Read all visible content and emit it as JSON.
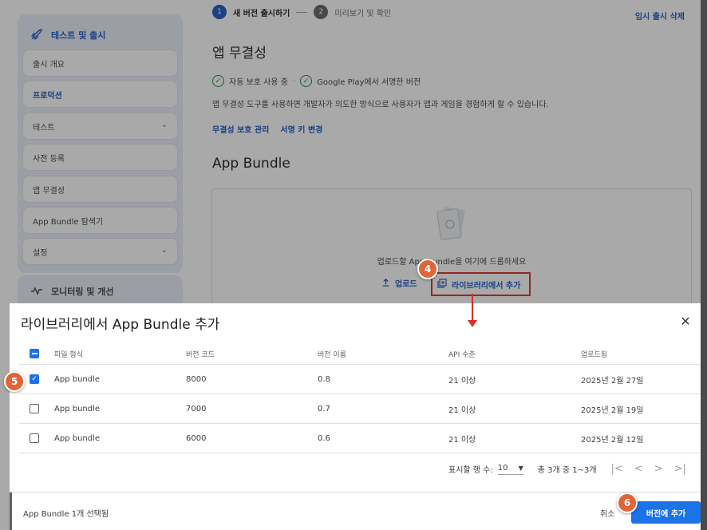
{
  "sidebar": {
    "section_title": "테스트 및 출시",
    "items": [
      {
        "label": "출시 개요"
      },
      {
        "label": "프로덕션"
      },
      {
        "label": "테스트"
      },
      {
        "label": "사전 등록"
      },
      {
        "label": "앱 무결성"
      },
      {
        "label": "App Bundle 탐색기"
      },
      {
        "label": "설정"
      }
    ],
    "section2_title": "모니터링 및 개선"
  },
  "stepper": {
    "step1_num": "1",
    "step1_label": "새 버전 출시하기",
    "step2_num": "2",
    "step2_label": "미리보기 및 확인"
  },
  "discard_label": "임시 출시 삭제",
  "integrity": {
    "heading": "앱 무결성",
    "check1": "자동 보호 사용 중",
    "sep": "·",
    "check2": "Google Play에서 서명한 버전",
    "description": "앱 무결성 도구를 사용하면 개발자가 의도한 방식으로 사용자가 앱과 게임을 경험하게 할 수 있습니다.",
    "link1": "무결성 보호 관리",
    "link2": "서명 키 변경"
  },
  "bundle_section": {
    "heading": "App Bundle",
    "drop_text": "업로드할 App Bundle을 여기에 드롭하세요",
    "upload_label": "업로드",
    "add_from_library_label": "라이브러리에서 추가"
  },
  "dialog": {
    "title": "라이브러리에서 App Bundle 추가",
    "columns": [
      "파일 형식",
      "버전 코드",
      "버전 이름",
      "API 수준",
      "업로드됨"
    ],
    "rows": [
      {
        "checked": true,
        "type": "App bundle",
        "code": "8000",
        "name": "0.8",
        "api": "21 이상",
        "uploaded": "2025년 2월 27일"
      },
      {
        "checked": false,
        "type": "App bundle",
        "code": "7000",
        "name": "0.7",
        "api": "21 이상",
        "uploaded": "2025년 2월 19일"
      },
      {
        "checked": false,
        "type": "App bundle",
        "code": "6000",
        "name": "0.6",
        "api": "21 이상",
        "uploaded": "2025년 2월 12일"
      }
    ],
    "pagination": {
      "rows_per_page_label": "표시할 행 수:",
      "rows_per_page_value": "10",
      "range_text": "총 3개 중 1~3개"
    },
    "footer": {
      "selected_text": "App Bundle 1개 선택됨",
      "cancel_label": "취소",
      "add_version_label": "버전에 추가"
    }
  },
  "annotations": {
    "badge4": "4",
    "badge5": "5",
    "badge6": "6"
  },
  "colors": {
    "accent": "#1a73e8",
    "highlight": "#d93025",
    "badge": "#e06538",
    "check": "#188038"
  }
}
